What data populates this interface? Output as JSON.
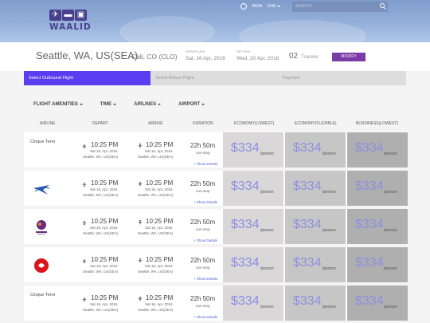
{
  "header": {
    "logo_text": "WAALID",
    "links": [
      "INDIA",
      "ENG"
    ],
    "search_placeholder": "SEARCH"
  },
  "summary": {
    "from": "Seattle, WA, US(SEA)",
    "to": "Cali, CO (CLO)",
    "departure_label": "DEPARTURE",
    "departure": "Sat, 16 Apr, 2016",
    "return_label": "RETURN",
    "return": "Wed, 20 Apr, 2016",
    "travelers_count": "02",
    "travelers_label": "Traveler",
    "modify_label": "MODIFY"
  },
  "steps": [
    {
      "label": "Select Outbound Flight",
      "active": true
    },
    {
      "label": "Select Return Flight",
      "active": false
    },
    {
      "label": "Payment",
      "active": false
    }
  ],
  "filters": [
    "FLIGHT AMENITIES",
    "TIME",
    "AIRLINES",
    "AIRPORT"
  ],
  "columns": [
    "AIRLINE",
    "DEPART",
    "ARRIVE",
    "DURATION",
    "ECONOMY(LOWEST)",
    "ECONOMY(FLEXIBLE)",
    "BUSSINESS(LOWEST)"
  ],
  "flights": [
    {
      "airline": "Cinque Terre",
      "depart_time": "10:25 PM",
      "depart_date": "Sat 16, Apr, 2016",
      "depart_city": "Seattle, WA, US(SEA)",
      "arrive_time": "10:25 PM",
      "arrive_date": "Sat 16, Apr, 2016",
      "arrive_city": "Seattle, WA, US(SEA)",
      "duration": "22h 50m",
      "stops": "non-stop",
      "details": "+ Show Details",
      "fares": [
        "$334",
        "$334",
        "$334"
      ],
      "per": "/person"
    },
    {
      "airline": "",
      "depart_time": "10:25 PM",
      "depart_date": "Sat 16, Apr, 2016",
      "depart_city": "Seattle, WA, US(SEA)",
      "arrive_time": "10:25 PM",
      "arrive_date": "Sat 16, Apr, 2016",
      "arrive_city": "Seattle, WA, US(SEA)",
      "duration": "22h 50m",
      "stops": "non-stop",
      "details": "+ Show Details",
      "fares": [
        "$334",
        "$334",
        "$334"
      ],
      "per": "/person"
    },
    {
      "airline": "",
      "depart_time": "10:25 PM",
      "depart_date": "Sat 16, Apr, 2016",
      "depart_city": "Seattle, WA, US(SEA)",
      "arrive_time": "10:25 PM",
      "arrive_date": "Sat 16, Apr, 2016",
      "arrive_city": "Seattle, WA, US(SEA)",
      "duration": "22h 50m",
      "stops": "non-stop",
      "details": "+ Show Details",
      "fares": [
        "$334",
        "$334",
        "$334"
      ],
      "per": "/person"
    },
    {
      "airline": "",
      "depart_time": "10:25 PM",
      "depart_date": "Sat 16, Apr, 2016",
      "depart_city": "Seattle, WA, US(SEA)",
      "arrive_time": "10:25 PM",
      "arrive_date": "Sat 16, Apr, 2016",
      "arrive_city": "Seattle, WA, US(SEA)",
      "duration": "22h 50m",
      "stops": "non-stop",
      "details": "+ Show Details",
      "fares": [
        "$334",
        "$334",
        "$334"
      ],
      "per": "/person"
    },
    {
      "airline": "Cinque Terre",
      "depart_time": "10:25 PM",
      "depart_date": "Sat 16, Apr, 2016",
      "depart_city": "Seattle, WA, US(SEA)",
      "arrive_time": "10:25 PM",
      "arrive_date": "Sat 16, Apr, 2016",
      "arrive_city": "Seattle, WA, US(SEA)",
      "duration": "22h 50m",
      "stops": "non-stop",
      "details": "+ Show Details",
      "fares": [
        "$334",
        "$334",
        "$334"
      ],
      "per": "/person"
    }
  ]
}
